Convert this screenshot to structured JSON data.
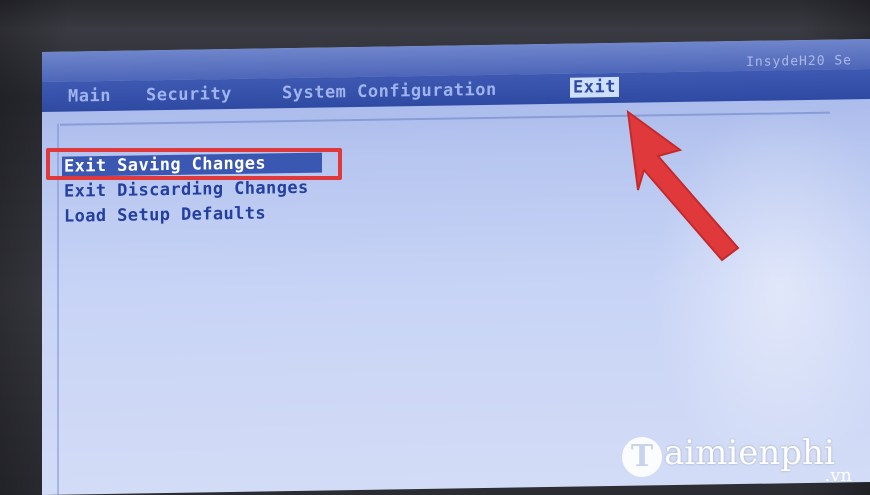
{
  "bios": {
    "vendor": "InsydeH20 Se",
    "menu": [
      {
        "label": "Main"
      },
      {
        "label": "Security"
      },
      {
        "label": "System Configuration"
      },
      {
        "label": "Exit",
        "active": true
      }
    ],
    "options": [
      {
        "label": "Exit Saving Changes",
        "selected": true
      },
      {
        "label": "Exit Discarding Changes"
      },
      {
        "label": "Load Setup Defaults"
      }
    ]
  },
  "colors": {
    "screen_bg": "#c8d4f6",
    "menubar_bg": "#2f4aa3",
    "text_blue": "#2340a0",
    "annotation_red": "#e0393b"
  },
  "watermark": {
    "logo_letter": "T",
    "text": "aimienphi",
    "suffix": ".vn"
  }
}
